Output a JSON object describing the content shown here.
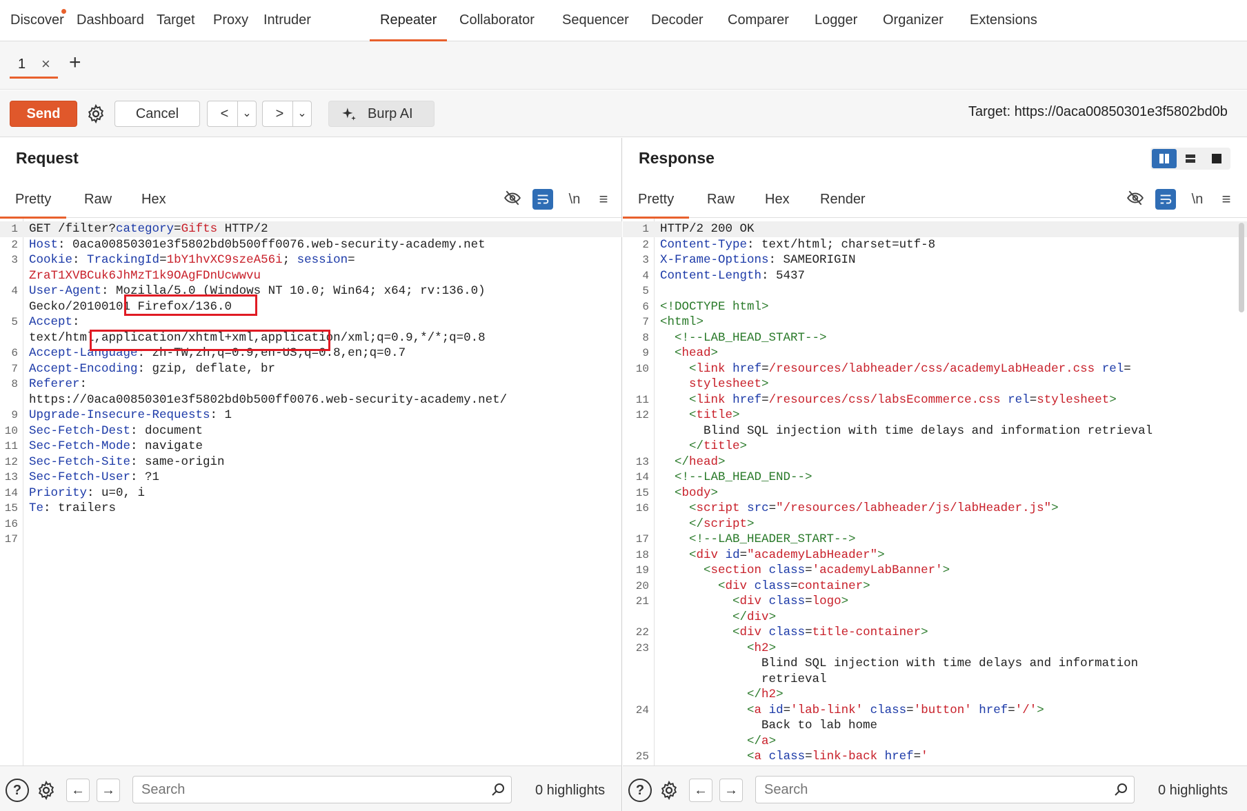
{
  "nav": {
    "items": [
      "Discover",
      "Dashboard",
      "Target",
      "Proxy",
      "Intruder",
      "Repeater",
      "Collaborator",
      "Sequencer",
      "Decoder",
      "Comparer",
      "Logger",
      "Organizer",
      "Extensions"
    ],
    "active": "Repeater"
  },
  "tabs": {
    "tab1_label": "1",
    "close_glyph": "×",
    "add_glyph": "+"
  },
  "toolbar": {
    "send_label": "Send",
    "cancel_label": "Cancel",
    "back_glyph": "<",
    "forward_glyph": ">",
    "dropdown_glyph": "⌄",
    "burp_ai_label": "Burp AI",
    "target_text": "Target: https://0aca00850301e3f5802bd0b"
  },
  "request": {
    "title": "Request",
    "subtabs": [
      "Pretty",
      "Raw",
      "Hex"
    ],
    "newline_label": "\\n",
    "lines": [
      {
        "n": "1",
        "parts": [
          [
            "v",
            "GET /filter?"
          ],
          [
            "k",
            "category"
          ],
          [
            "v",
            "="
          ],
          [
            "red",
            "Gifts"
          ],
          [
            "v",
            " HTTP/2"
          ]
        ]
      },
      {
        "n": "2",
        "parts": [
          [
            "k",
            "Host"
          ],
          [
            "v",
            ": 0aca00850301e3f5802bd0b500ff0076.web-security-academy.net"
          ]
        ]
      },
      {
        "n": "3",
        "parts": [
          [
            "k",
            "Cookie"
          ],
          [
            "v",
            ": "
          ],
          [
            "k",
            "TrackingId"
          ],
          [
            "v",
            "="
          ],
          [
            "red",
            "1bY1hvXC9szeA56i"
          ],
          [
            "v",
            "; "
          ],
          [
            "k",
            "session"
          ],
          [
            "v",
            "="
          ]
        ]
      },
      {
        "n": "",
        "parts": [
          [
            "red",
            "ZraT1XVBCuk6JhMzT1k9OAgFDnUcwwvu"
          ]
        ]
      },
      {
        "n": "4",
        "parts": [
          [
            "k",
            "User-Agent"
          ],
          [
            "v",
            ": Mozilla/5.0 (Windows NT 10.0; Win64; x64; rv:136.0)"
          ]
        ]
      },
      {
        "n": "",
        "parts": [
          [
            "v",
            "Gecko/20100101 Firefox/136.0"
          ]
        ]
      },
      {
        "n": "5",
        "parts": [
          [
            "k",
            "Accept"
          ],
          [
            "v",
            ":"
          ]
        ]
      },
      {
        "n": "",
        "parts": [
          [
            "v",
            "text/html,application/xhtml+xml,application/xml;q=0.9,*/*;q=0.8"
          ]
        ]
      },
      {
        "n": "6",
        "parts": [
          [
            "k",
            "Accept-Language"
          ],
          [
            "v",
            ": zh-TW,zh;q=0.9,en-US;q=0.8,en;q=0.7"
          ]
        ]
      },
      {
        "n": "7",
        "parts": [
          [
            "k",
            "Accept-Encoding"
          ],
          [
            "v",
            ": gzip, deflate, br"
          ]
        ]
      },
      {
        "n": "8",
        "parts": [
          [
            "k",
            "Referer"
          ],
          [
            "v",
            ":"
          ]
        ]
      },
      {
        "n": "",
        "parts": [
          [
            "v",
            "https://0aca00850301e3f5802bd0b500ff0076.web-security-academy.net/"
          ]
        ]
      },
      {
        "n": "9",
        "parts": [
          [
            "k",
            "Upgrade-Insecure-Requests"
          ],
          [
            "v",
            ": 1"
          ]
        ]
      },
      {
        "n": "10",
        "parts": [
          [
            "k",
            "Sec-Fetch-Dest"
          ],
          [
            "v",
            ": document"
          ]
        ]
      },
      {
        "n": "11",
        "parts": [
          [
            "k",
            "Sec-Fetch-Mode"
          ],
          [
            "v",
            ": navigate"
          ]
        ]
      },
      {
        "n": "12",
        "parts": [
          [
            "k",
            "Sec-Fetch-Site"
          ],
          [
            "v",
            ": same-origin"
          ]
        ]
      },
      {
        "n": "13",
        "parts": [
          [
            "k",
            "Sec-Fetch-User"
          ],
          [
            "v",
            ": ?1"
          ]
        ]
      },
      {
        "n": "14",
        "parts": [
          [
            "k",
            "Priority"
          ],
          [
            "v",
            ": u=0, i"
          ]
        ]
      },
      {
        "n": "15",
        "parts": [
          [
            "k",
            "Te"
          ],
          [
            "v",
            ": trailers"
          ]
        ]
      },
      {
        "n": "16",
        "parts": []
      },
      {
        "n": "17",
        "parts": []
      }
    ]
  },
  "response": {
    "title": "Response",
    "subtabs": [
      "Pretty",
      "Raw",
      "Hex",
      "Render"
    ],
    "newline_label": "\\n",
    "lines": [
      {
        "n": "1",
        "parts": [
          [
            "v",
            "HTTP/2 200 OK"
          ]
        ]
      },
      {
        "n": "2",
        "parts": [
          [
            "k",
            "Content-Type"
          ],
          [
            "v",
            ": text/html; charset=utf-8"
          ]
        ]
      },
      {
        "n": "3",
        "parts": [
          [
            "k",
            "X-Frame-Options"
          ],
          [
            "v",
            ": SAMEORIGIN"
          ]
        ]
      },
      {
        "n": "4",
        "parts": [
          [
            "k",
            "Content-Length"
          ],
          [
            "v",
            ": 5437"
          ]
        ]
      },
      {
        "n": "5",
        "parts": []
      },
      {
        "n": "6",
        "parts": [
          [
            "green",
            "<!DOCTYPE html>"
          ]
        ]
      },
      {
        "n": "7",
        "parts": [
          [
            "green",
            "<html>"
          ]
        ]
      },
      {
        "n": "8",
        "parts": [
          [
            "v",
            "  "
          ],
          [
            "green",
            "<!--LAB_HEAD_START-->"
          ]
        ]
      },
      {
        "n": "9",
        "parts": [
          [
            "v",
            "  "
          ],
          [
            "green",
            "<"
          ],
          [
            "red",
            "head"
          ],
          [
            "green",
            ">"
          ]
        ]
      },
      {
        "n": "10",
        "parts": [
          [
            "v",
            "    "
          ],
          [
            "green",
            "<"
          ],
          [
            "red",
            "link"
          ],
          [
            "v",
            " "
          ],
          [
            "k",
            "href"
          ],
          [
            "v",
            "="
          ],
          [
            "red",
            "/resources/labheader/css/academyLabHeader.css"
          ],
          [
            "v",
            " "
          ],
          [
            "k",
            "rel"
          ],
          [
            "v",
            "="
          ]
        ]
      },
      {
        "n": "",
        "parts": [
          [
            "v",
            "    "
          ],
          [
            "red",
            "stylesheet"
          ],
          [
            "green",
            ">"
          ]
        ]
      },
      {
        "n": "11",
        "parts": [
          [
            "v",
            "    "
          ],
          [
            "green",
            "<"
          ],
          [
            "red",
            "link"
          ],
          [
            "v",
            " "
          ],
          [
            "k",
            "href"
          ],
          [
            "v",
            "="
          ],
          [
            "red",
            "/resources/css/labsEcommerce.css"
          ],
          [
            "v",
            " "
          ],
          [
            "k",
            "rel"
          ],
          [
            "v",
            "="
          ],
          [
            "red",
            "stylesheet"
          ],
          [
            "green",
            ">"
          ]
        ]
      },
      {
        "n": "12",
        "parts": [
          [
            "v",
            "    "
          ],
          [
            "green",
            "<"
          ],
          [
            "red",
            "title"
          ],
          [
            "green",
            ">"
          ]
        ]
      },
      {
        "n": "",
        "parts": [
          [
            "v",
            "      Blind SQL injection with time delays and information retrieval"
          ]
        ]
      },
      {
        "n": "",
        "parts": [
          [
            "v",
            "    "
          ],
          [
            "green",
            "</"
          ],
          [
            "red",
            "title"
          ],
          [
            "green",
            ">"
          ]
        ]
      },
      {
        "n": "13",
        "parts": [
          [
            "v",
            "  "
          ],
          [
            "green",
            "</"
          ],
          [
            "red",
            "head"
          ],
          [
            "green",
            ">"
          ]
        ]
      },
      {
        "n": "14",
        "parts": [
          [
            "v",
            "  "
          ],
          [
            "green",
            "<!--LAB_HEAD_END-->"
          ]
        ]
      },
      {
        "n": "15",
        "parts": [
          [
            "v",
            "  "
          ],
          [
            "green",
            "<"
          ],
          [
            "red",
            "body"
          ],
          [
            "green",
            ">"
          ]
        ]
      },
      {
        "n": "16",
        "parts": [
          [
            "v",
            "    "
          ],
          [
            "green",
            "<"
          ],
          [
            "red",
            "script"
          ],
          [
            "v",
            " "
          ],
          [
            "k",
            "src"
          ],
          [
            "v",
            "="
          ],
          [
            "red",
            "\"/resources/labheader/js/labHeader.js\""
          ],
          [
            "green",
            ">"
          ]
        ]
      },
      {
        "n": "",
        "parts": [
          [
            "v",
            "    "
          ],
          [
            "green",
            "</"
          ],
          [
            "red",
            "script"
          ],
          [
            "green",
            ">"
          ]
        ]
      },
      {
        "n": "17",
        "parts": [
          [
            "v",
            "    "
          ],
          [
            "green",
            "<!--LAB_HEADER_START-->"
          ]
        ]
      },
      {
        "n": "18",
        "parts": [
          [
            "v",
            "    "
          ],
          [
            "green",
            "<"
          ],
          [
            "red",
            "div"
          ],
          [
            "v",
            " "
          ],
          [
            "k",
            "id"
          ],
          [
            "v",
            "="
          ],
          [
            "red",
            "\"academyLabHeader\""
          ],
          [
            "green",
            ">"
          ]
        ]
      },
      {
        "n": "19",
        "parts": [
          [
            "v",
            "      "
          ],
          [
            "green",
            "<"
          ],
          [
            "red",
            "section"
          ],
          [
            "v",
            " "
          ],
          [
            "k",
            "class"
          ],
          [
            "v",
            "="
          ],
          [
            "red",
            "'academyLabBanner'"
          ],
          [
            "green",
            ">"
          ]
        ]
      },
      {
        "n": "20",
        "parts": [
          [
            "v",
            "        "
          ],
          [
            "green",
            "<"
          ],
          [
            "red",
            "div"
          ],
          [
            "v",
            " "
          ],
          [
            "k",
            "class"
          ],
          [
            "v",
            "="
          ],
          [
            "red",
            "container"
          ],
          [
            "green",
            ">"
          ]
        ]
      },
      {
        "n": "21",
        "parts": [
          [
            "v",
            "          "
          ],
          [
            "green",
            "<"
          ],
          [
            "red",
            "div"
          ],
          [
            "v",
            " "
          ],
          [
            "k",
            "class"
          ],
          [
            "v",
            "="
          ],
          [
            "red",
            "logo"
          ],
          [
            "green",
            ">"
          ]
        ]
      },
      {
        "n": "",
        "parts": [
          [
            "v",
            "          "
          ],
          [
            "green",
            "</"
          ],
          [
            "red",
            "div"
          ],
          [
            "green",
            ">"
          ]
        ]
      },
      {
        "n": "22",
        "parts": [
          [
            "v",
            "          "
          ],
          [
            "green",
            "<"
          ],
          [
            "red",
            "div"
          ],
          [
            "v",
            " "
          ],
          [
            "k",
            "class"
          ],
          [
            "v",
            "="
          ],
          [
            "red",
            "title-container"
          ],
          [
            "green",
            ">"
          ]
        ]
      },
      {
        "n": "23",
        "parts": [
          [
            "v",
            "            "
          ],
          [
            "green",
            "<"
          ],
          [
            "red",
            "h2"
          ],
          [
            "green",
            ">"
          ]
        ]
      },
      {
        "n": "",
        "parts": [
          [
            "v",
            "              Blind SQL injection with time delays and information"
          ]
        ]
      },
      {
        "n": "",
        "parts": [
          [
            "v",
            "              retrieval"
          ]
        ]
      },
      {
        "n": "",
        "parts": [
          [
            "v",
            "            "
          ],
          [
            "green",
            "</"
          ],
          [
            "red",
            "h2"
          ],
          [
            "green",
            ">"
          ]
        ]
      },
      {
        "n": "24",
        "parts": [
          [
            "v",
            "            "
          ],
          [
            "green",
            "<"
          ],
          [
            "red",
            "a"
          ],
          [
            "v",
            " "
          ],
          [
            "k",
            "id"
          ],
          [
            "v",
            "="
          ],
          [
            "red",
            "'lab-link'"
          ],
          [
            "v",
            " "
          ],
          [
            "k",
            "class"
          ],
          [
            "v",
            "="
          ],
          [
            "red",
            "'button'"
          ],
          [
            "v",
            " "
          ],
          [
            "k",
            "href"
          ],
          [
            "v",
            "="
          ],
          [
            "red",
            "'/'"
          ],
          [
            "green",
            ">"
          ]
        ]
      },
      {
        "n": "",
        "parts": [
          [
            "v",
            "              Back to lab home"
          ]
        ]
      },
      {
        "n": "",
        "parts": [
          [
            "v",
            "            "
          ],
          [
            "green",
            "</"
          ],
          [
            "red",
            "a"
          ],
          [
            "green",
            ">"
          ]
        ]
      },
      {
        "n": "25",
        "parts": [
          [
            "v",
            "            "
          ],
          [
            "green",
            "<"
          ],
          [
            "red",
            "a"
          ],
          [
            "v",
            " "
          ],
          [
            "k",
            "class"
          ],
          [
            "v",
            "="
          ],
          [
            "red",
            "link-back"
          ],
          [
            "v",
            " "
          ],
          [
            "k",
            "href"
          ],
          [
            "v",
            "="
          ],
          [
            "red",
            "'"
          ]
        ]
      }
    ]
  },
  "footer": {
    "help_glyph": "?",
    "search_placeholder": "Search",
    "left_highlights": "0 highlights",
    "right_highlights": "0 highlights"
  },
  "colors": {
    "accent": "#e8602c",
    "send": "#e0582b",
    "key": "#1c3aa8",
    "value_red": "#c8202a",
    "tag_green": "#2a7a2a",
    "annotation_box": "#e01b24"
  }
}
